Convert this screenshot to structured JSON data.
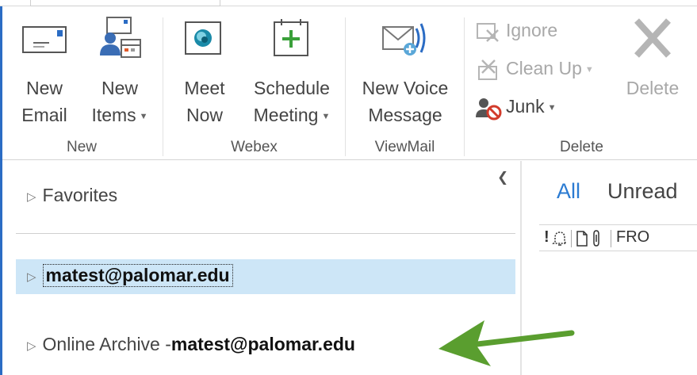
{
  "ribbon": {
    "groups": {
      "new": {
        "label": "New",
        "new_email": {
          "line1": "New",
          "line2": "Email"
        },
        "new_items": {
          "line1": "New",
          "line2": "Items"
        }
      },
      "webex": {
        "label": "Webex",
        "meet_now": {
          "line1": "Meet",
          "line2": "Now"
        },
        "schedule_meeting": {
          "line1": "Schedule",
          "line2": "Meeting"
        }
      },
      "viewmail": {
        "label": "ViewMail",
        "new_voice_message": {
          "line1": "New Voice",
          "line2": "Message"
        }
      },
      "delete": {
        "label": "Delete",
        "ignore": "Ignore",
        "clean_up": "Clean Up",
        "junk": "Junk",
        "delete": "Delete"
      }
    }
  },
  "folder_pane": {
    "favorites": "Favorites",
    "account": "matest@palomar.edu",
    "archive_prefix": "Online Archive -",
    "archive_account": "matest@palomar.edu"
  },
  "message_list": {
    "filter_all": "All",
    "filter_unread": "Unread",
    "columns": {
      "importance": "!",
      "from": "FRO"
    }
  },
  "colors": {
    "accent": "#2b7bd2",
    "selection": "#cde6f7",
    "arrow": "#5a9e2f",
    "window_border": "#2b6cc4"
  }
}
